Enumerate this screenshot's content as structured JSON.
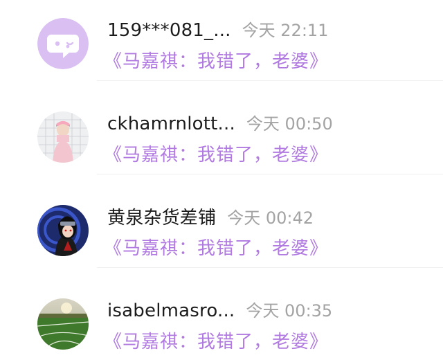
{
  "conversations": [
    {
      "name": "159***081_...",
      "time": "今天 22:11",
      "message": "《马嘉祺：我错了，老婆》",
      "avatar_icon": "default-avatar-chat-icon",
      "avatar_color": "#d9bff2"
    },
    {
      "name": "ckhamrnlott...",
      "time": "今天 00:50",
      "message": "《马嘉祺：我错了，老婆》",
      "avatar_icon": "photo-avatar-girl-pink"
    },
    {
      "name": "黄泉杂货差铺",
      "time": "今天 00:42",
      "message": "《马嘉祺：我错了，老婆》",
      "avatar_icon": "anime-character-avatar"
    },
    {
      "name": "isabelmasro...",
      "time": "今天 00:35",
      "message": "《马嘉祺：我错了，老婆》",
      "avatar_icon": "soccer-field-avatar"
    }
  ],
  "colors": {
    "message": "#b07ae0",
    "name": "#1c1c1c",
    "time": "#a3a3a3"
  }
}
